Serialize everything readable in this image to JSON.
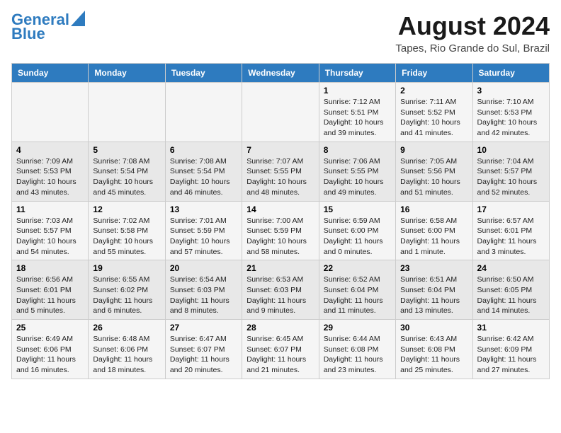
{
  "header": {
    "logo_line1": "General",
    "logo_line2": "Blue",
    "month": "August 2024",
    "location": "Tapes, Rio Grande do Sul, Brazil"
  },
  "days_of_week": [
    "Sunday",
    "Monday",
    "Tuesday",
    "Wednesday",
    "Thursday",
    "Friday",
    "Saturday"
  ],
  "weeks": [
    [
      {
        "day": "",
        "info": ""
      },
      {
        "day": "",
        "info": ""
      },
      {
        "day": "",
        "info": ""
      },
      {
        "day": "",
        "info": ""
      },
      {
        "day": "1",
        "info": "Sunrise: 7:12 AM\nSunset: 5:51 PM\nDaylight: 10 hours\nand 39 minutes."
      },
      {
        "day": "2",
        "info": "Sunrise: 7:11 AM\nSunset: 5:52 PM\nDaylight: 10 hours\nand 41 minutes."
      },
      {
        "day": "3",
        "info": "Sunrise: 7:10 AM\nSunset: 5:53 PM\nDaylight: 10 hours\nand 42 minutes."
      }
    ],
    [
      {
        "day": "4",
        "info": "Sunrise: 7:09 AM\nSunset: 5:53 PM\nDaylight: 10 hours\nand 43 minutes."
      },
      {
        "day": "5",
        "info": "Sunrise: 7:08 AM\nSunset: 5:54 PM\nDaylight: 10 hours\nand 45 minutes."
      },
      {
        "day": "6",
        "info": "Sunrise: 7:08 AM\nSunset: 5:54 PM\nDaylight: 10 hours\nand 46 minutes."
      },
      {
        "day": "7",
        "info": "Sunrise: 7:07 AM\nSunset: 5:55 PM\nDaylight: 10 hours\nand 48 minutes."
      },
      {
        "day": "8",
        "info": "Sunrise: 7:06 AM\nSunset: 5:55 PM\nDaylight: 10 hours\nand 49 minutes."
      },
      {
        "day": "9",
        "info": "Sunrise: 7:05 AM\nSunset: 5:56 PM\nDaylight: 10 hours\nand 51 minutes."
      },
      {
        "day": "10",
        "info": "Sunrise: 7:04 AM\nSunset: 5:57 PM\nDaylight: 10 hours\nand 52 minutes."
      }
    ],
    [
      {
        "day": "11",
        "info": "Sunrise: 7:03 AM\nSunset: 5:57 PM\nDaylight: 10 hours\nand 54 minutes."
      },
      {
        "day": "12",
        "info": "Sunrise: 7:02 AM\nSunset: 5:58 PM\nDaylight: 10 hours\nand 55 minutes."
      },
      {
        "day": "13",
        "info": "Sunrise: 7:01 AM\nSunset: 5:59 PM\nDaylight: 10 hours\nand 57 minutes."
      },
      {
        "day": "14",
        "info": "Sunrise: 7:00 AM\nSunset: 5:59 PM\nDaylight: 10 hours\nand 58 minutes."
      },
      {
        "day": "15",
        "info": "Sunrise: 6:59 AM\nSunset: 6:00 PM\nDaylight: 11 hours\nand 0 minutes."
      },
      {
        "day": "16",
        "info": "Sunrise: 6:58 AM\nSunset: 6:00 PM\nDaylight: 11 hours\nand 1 minute."
      },
      {
        "day": "17",
        "info": "Sunrise: 6:57 AM\nSunset: 6:01 PM\nDaylight: 11 hours\nand 3 minutes."
      }
    ],
    [
      {
        "day": "18",
        "info": "Sunrise: 6:56 AM\nSunset: 6:01 PM\nDaylight: 11 hours\nand 5 minutes."
      },
      {
        "day": "19",
        "info": "Sunrise: 6:55 AM\nSunset: 6:02 PM\nDaylight: 11 hours\nand 6 minutes."
      },
      {
        "day": "20",
        "info": "Sunrise: 6:54 AM\nSunset: 6:03 PM\nDaylight: 11 hours\nand 8 minutes."
      },
      {
        "day": "21",
        "info": "Sunrise: 6:53 AM\nSunset: 6:03 PM\nDaylight: 11 hours\nand 9 minutes."
      },
      {
        "day": "22",
        "info": "Sunrise: 6:52 AM\nSunset: 6:04 PM\nDaylight: 11 hours\nand 11 minutes."
      },
      {
        "day": "23",
        "info": "Sunrise: 6:51 AM\nSunset: 6:04 PM\nDaylight: 11 hours\nand 13 minutes."
      },
      {
        "day": "24",
        "info": "Sunrise: 6:50 AM\nSunset: 6:05 PM\nDaylight: 11 hours\nand 14 minutes."
      }
    ],
    [
      {
        "day": "25",
        "info": "Sunrise: 6:49 AM\nSunset: 6:06 PM\nDaylight: 11 hours\nand 16 minutes."
      },
      {
        "day": "26",
        "info": "Sunrise: 6:48 AM\nSunset: 6:06 PM\nDaylight: 11 hours\nand 18 minutes."
      },
      {
        "day": "27",
        "info": "Sunrise: 6:47 AM\nSunset: 6:07 PM\nDaylight: 11 hours\nand 20 minutes."
      },
      {
        "day": "28",
        "info": "Sunrise: 6:45 AM\nSunset: 6:07 PM\nDaylight: 11 hours\nand 21 minutes."
      },
      {
        "day": "29",
        "info": "Sunrise: 6:44 AM\nSunset: 6:08 PM\nDaylight: 11 hours\nand 23 minutes."
      },
      {
        "day": "30",
        "info": "Sunrise: 6:43 AM\nSunset: 6:08 PM\nDaylight: 11 hours\nand 25 minutes."
      },
      {
        "day": "31",
        "info": "Sunrise: 6:42 AM\nSunset: 6:09 PM\nDaylight: 11 hours\nand 27 minutes."
      }
    ]
  ]
}
